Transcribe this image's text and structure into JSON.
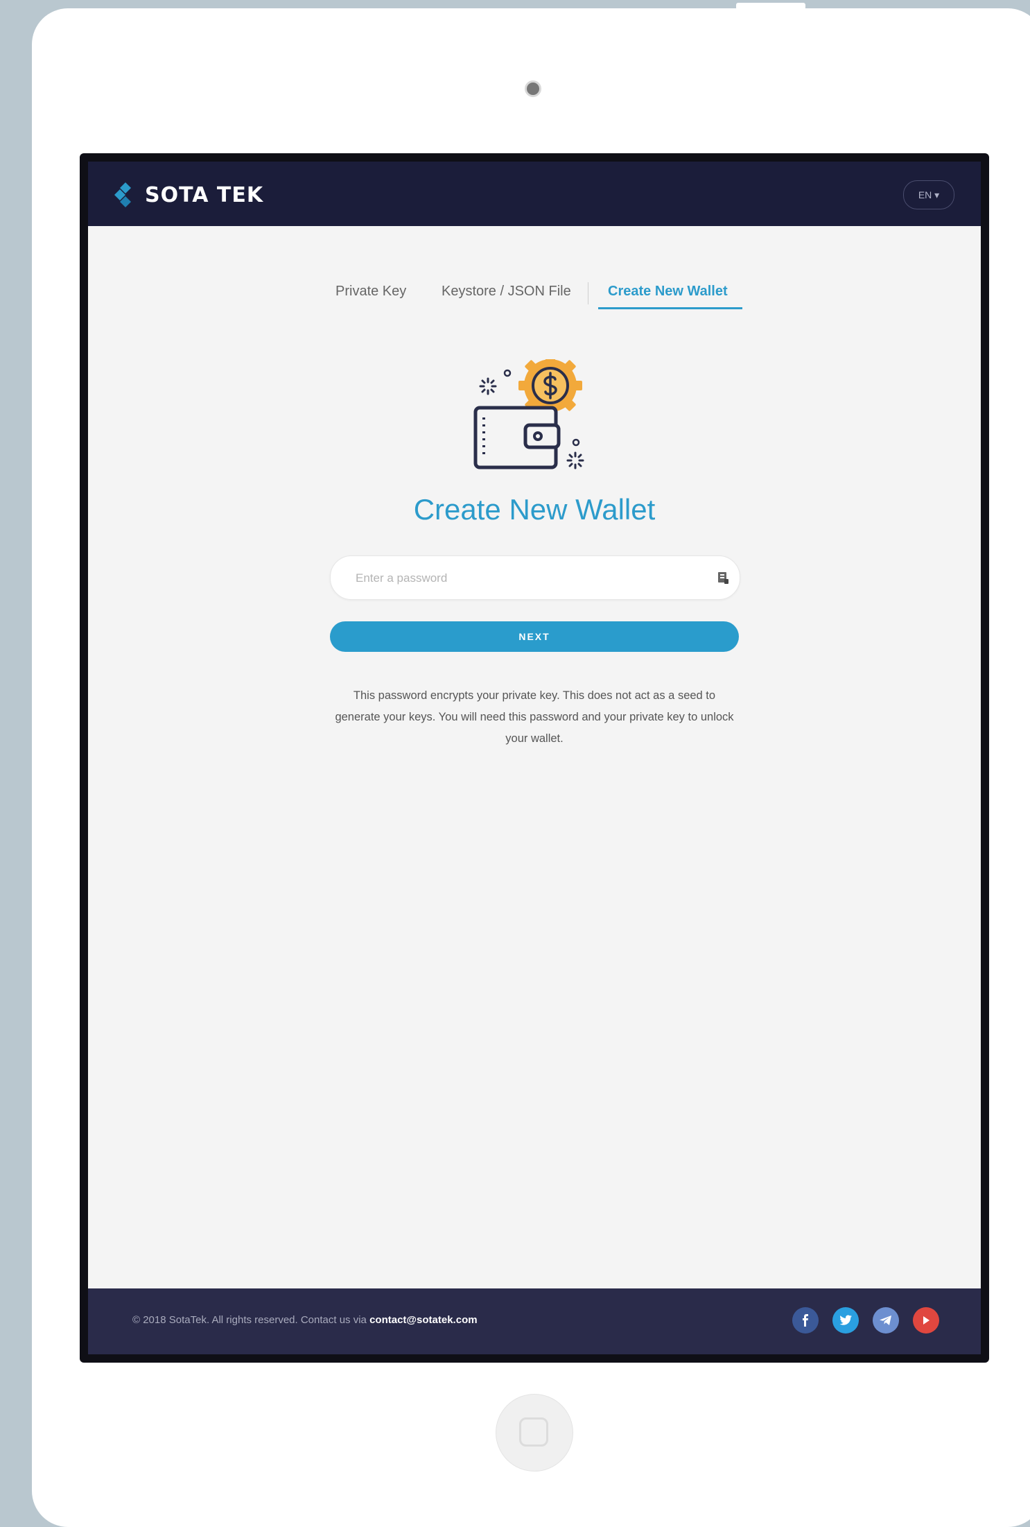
{
  "brand": {
    "name": "SOTA TEK"
  },
  "header": {
    "language": "EN ▾"
  },
  "tabs": [
    {
      "label": "Private Key"
    },
    {
      "label": "Keystore / JSON File"
    },
    {
      "label": "Create New Wallet"
    }
  ],
  "main": {
    "title": "Create New Wallet",
    "password_placeholder": "Enter a password",
    "next_label": "NEXT",
    "note": "This password encrypts your private key. This does not act as a seed to generate your keys. You will need this password and your private key to unlock your wallet."
  },
  "footer": {
    "copyright": "© 2018 SotaTek. All rights reserved. Contact us via ",
    "email": "contact@sotatek.com",
    "social": [
      "facebook-icon",
      "twitter-icon",
      "telegram-icon",
      "youtube-icon"
    ]
  },
  "colors": {
    "accent": "#2c9bcb",
    "header_bg": "#1b1d3a",
    "footer_bg": "#2a2b4a",
    "coin": "#f2a93b"
  }
}
